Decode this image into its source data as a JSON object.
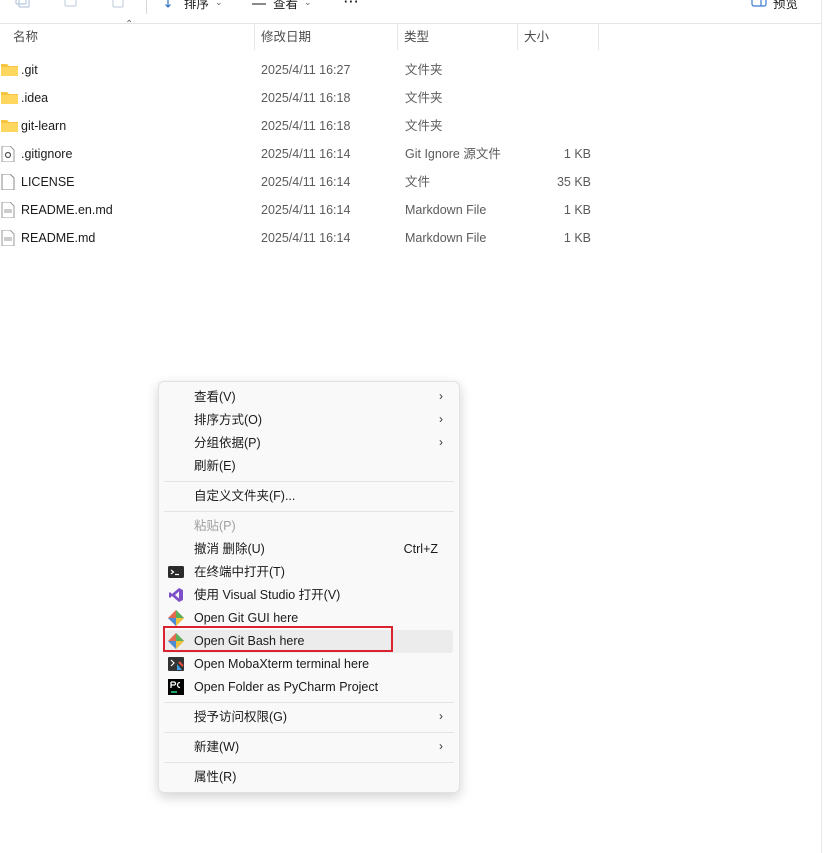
{
  "toolbar": {
    "sort_label": "排序",
    "view_label": "查看",
    "more_label": "···",
    "preview_label": "预览"
  },
  "columns": {
    "name": "名称",
    "date": "修改日期",
    "type": "类型",
    "size": "大小"
  },
  "files": [
    {
      "name": ".git",
      "date": "2025/4/11 16:27",
      "type": "文件夹",
      "size": "",
      "icon": "folder-icon"
    },
    {
      "name": ".idea",
      "date": "2025/4/11 16:18",
      "type": "文件夹",
      "size": "",
      "icon": "folder-icon"
    },
    {
      "name": "git-learn",
      "date": "2025/4/11 16:18",
      "type": "文件夹",
      "size": "",
      "icon": "folder-icon"
    },
    {
      "name": ".gitignore",
      "date": "2025/4/11 16:14",
      "type": "Git Ignore 源文件",
      "size": "1 KB",
      "icon": "gear-file-icon"
    },
    {
      "name": "LICENSE",
      "date": "2025/4/11 16:14",
      "type": "文件",
      "size": "35 KB",
      "icon": "blank-file-icon"
    },
    {
      "name": "README.en.md",
      "date": "2025/4/11 16:14",
      "type": "Markdown File",
      "size": "1 KB",
      "icon": "markdown-file-icon"
    },
    {
      "name": "README.md",
      "date": "2025/4/11 16:14",
      "type": "Markdown File",
      "size": "1 KB",
      "icon": "markdown-file-icon"
    }
  ],
  "context_menu": {
    "view": "查看(V)",
    "sort_by": "排序方式(O)",
    "group_by": "分组依据(P)",
    "refresh": "刷新(E)",
    "customize": "自定义文件夹(F)...",
    "paste": "粘贴(P)",
    "undo_delete": "撤消 删除(U)",
    "undo_shortcut": "Ctrl+Z",
    "open_terminal": "在终端中打开(T)",
    "open_vs": "使用 Visual Studio 打开(V)",
    "git_gui": "Open Git GUI here",
    "git_bash": "Open Git Bash here",
    "mobaxterm": "Open MobaXterm terminal here",
    "pycharm": "Open Folder as PyCharm Project",
    "give_access": "授予访问权限(G)",
    "new": "新建(W)",
    "properties": "属性(R)"
  },
  "colors": {
    "highlight_border": "#d9232e",
    "folder": "#f5c542",
    "menu_bg": "#f9f9f9"
  }
}
